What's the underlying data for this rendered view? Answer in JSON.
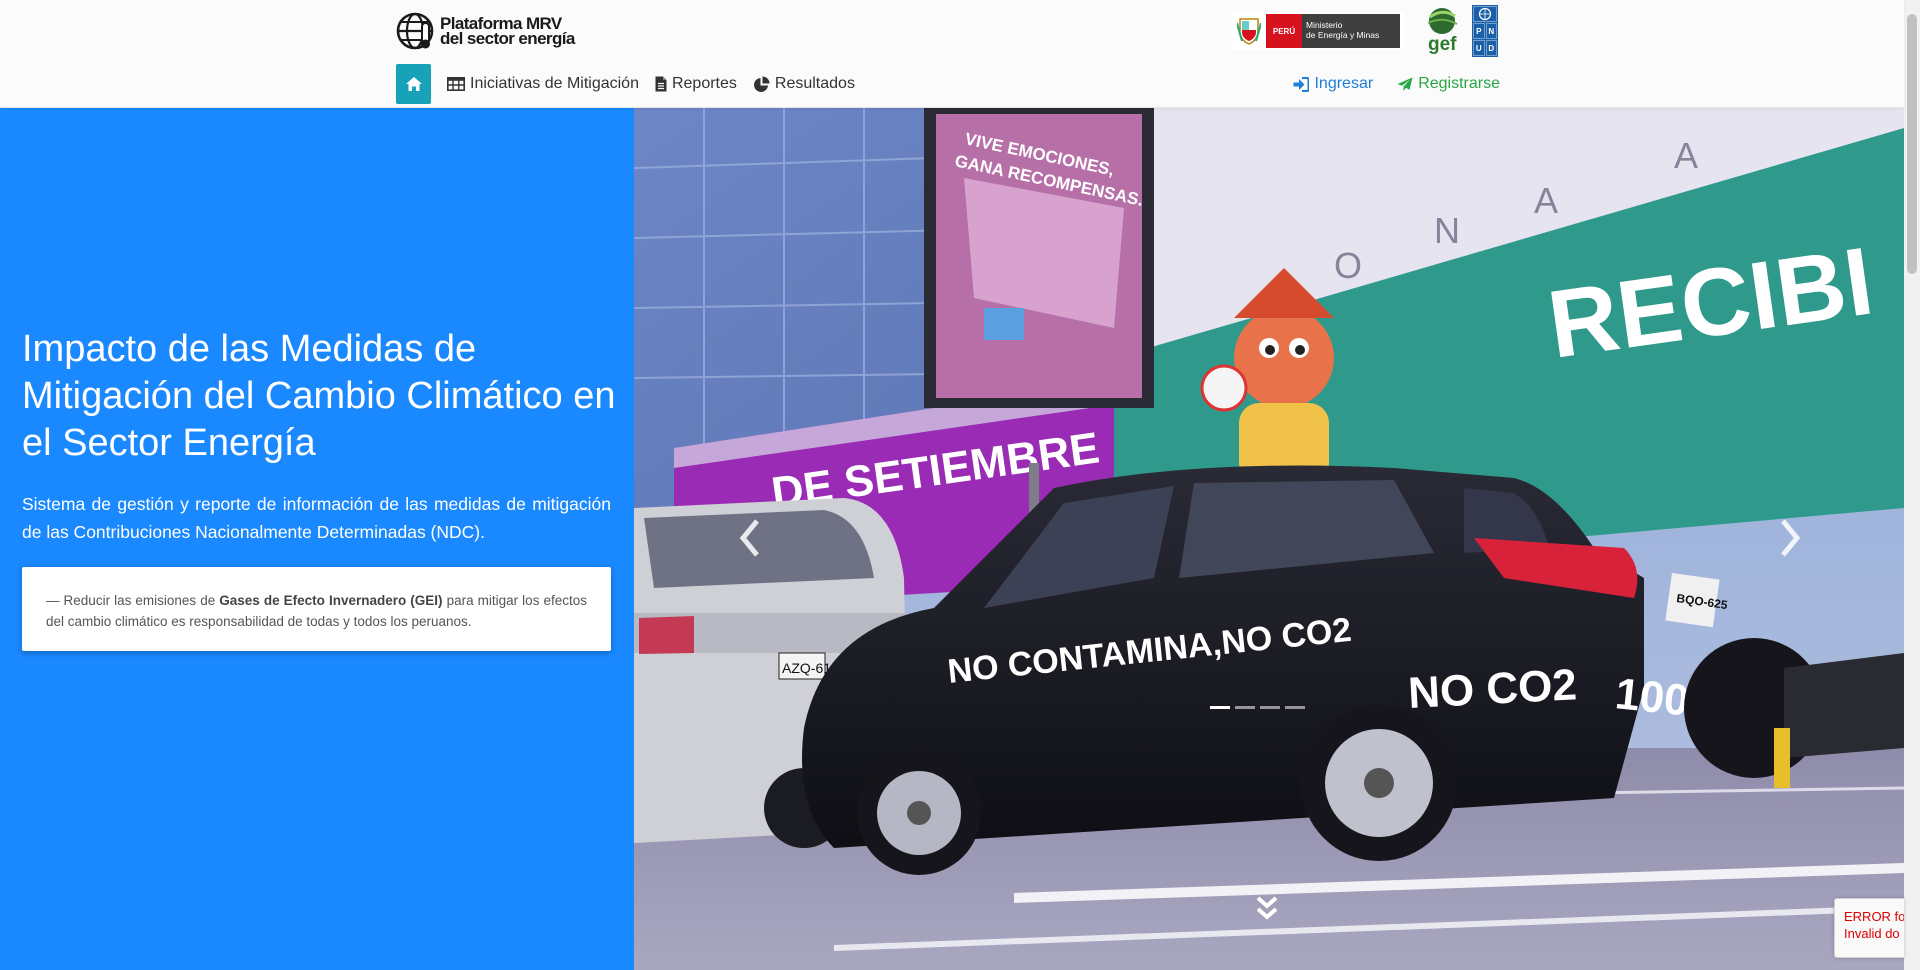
{
  "brand": {
    "line1": "Plataforma MRV",
    "line2": "del sector energía"
  },
  "partners": {
    "minem_country": "PERÚ",
    "minem_line1": "Ministerio",
    "minem_line2": "de Energía y Minas",
    "gef": "gef",
    "undp_top": "",
    "undp_letters": [
      "P",
      "N",
      "U",
      "D"
    ]
  },
  "nav": {
    "items": [
      {
        "label": "Iniciativas de Mitigación",
        "icon": "table-icon"
      },
      {
        "label": "Reportes",
        "icon": "file-icon"
      },
      {
        "label": "Resultados",
        "icon": "pie-chart-icon"
      }
    ],
    "login": "Ingresar",
    "register": "Registrarse"
  },
  "hero": {
    "title": "Impacto de las Medidas de Mitigación del Cambio Climático en el Sector Energía",
    "subtitle": "Sistema de gestión y reporte de información de las medidas de mitigación de las Contribuciones Nacionalmente Determinadas (NDC).",
    "quote_prefix": "— Reducir las emisiones de ",
    "quote_bold": "Gases de Efecto Invernadero (GEI)",
    "quote_suffix": " para mitigar los efectos del cambio climático es responsabilidad de todas y todos los peruanos."
  },
  "carousel": {
    "billboard_line1": "VIVE EMOCIONES,",
    "billboard_line2": "GANA RECOMPENSAS.",
    "banner_setiembre": "DE SETIEMBRE",
    "banner_recibi": "RECIBI",
    "car_text1": "NO CONTAMINA,NO CO2",
    "car_text2": "NO CO2",
    "car_text3": "100% ELÉCTRICO",
    "plate_rear": "BQO-625",
    "plate_van": "AZQ-610",
    "slide_count": 4,
    "active_slide": 1
  },
  "recaptcha": {
    "line1": "ERROR fo",
    "line2": "Invalid do"
  },
  "colors": {
    "accent": "#1a88fe",
    "home": "#17a2b8",
    "login": "#1e7fd9",
    "register": "#28a745"
  }
}
